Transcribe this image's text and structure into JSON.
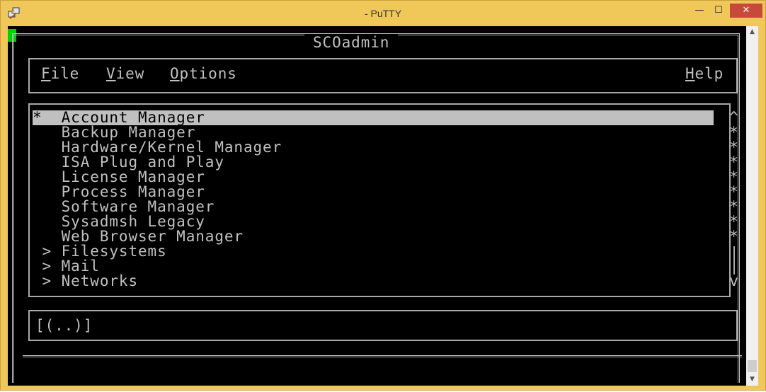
{
  "window": {
    "title": "- PuTTY",
    "app_icon": "putty-icon",
    "minimize_label": "—",
    "maximize_label": "☐",
    "close_label": "✕"
  },
  "terminal": {
    "app_title": "SCOadmin",
    "menu": {
      "file": "ile",
      "file_key": "F",
      "view": "iew",
      "view_key": "V",
      "options": "ptions",
      "options_key": "O",
      "help": "elp",
      "help_key": "H"
    },
    "list": {
      "items": [
        {
          "prefix": "*",
          "label": "Account Manager"
        },
        {
          "prefix": " ",
          "label": "Backup Manager"
        },
        {
          "prefix": " ",
          "label": "Hardware/Kernel Manager"
        },
        {
          "prefix": " ",
          "label": "ISA Plug and Play"
        },
        {
          "prefix": " ",
          "label": "License Manager"
        },
        {
          "prefix": " ",
          "label": "Process Manager"
        },
        {
          "prefix": " ",
          "label": "Software Manager"
        },
        {
          "prefix": " ",
          "label": "Sysadmsh Legacy"
        },
        {
          "prefix": " ",
          "label": "Web Browser Manager"
        },
        {
          "prefix": ">",
          "label": "Filesystems"
        },
        {
          "prefix": ">",
          "label": "Mail"
        },
        {
          "prefix": ">",
          "label": "Networks"
        }
      ],
      "scroll_up": "^",
      "scroll_down": "v",
      "scroll_marks": [
        "*",
        "*",
        "*",
        "*",
        "*",
        "*",
        "*",
        "*"
      ]
    },
    "status": "[(..)]"
  },
  "colors": {
    "frame": "#f0c85a",
    "terminal_bg": "#000000",
    "terminal_fg": "#c0c0c0",
    "cursor": "#00d000",
    "close_button": "#c7493a"
  }
}
